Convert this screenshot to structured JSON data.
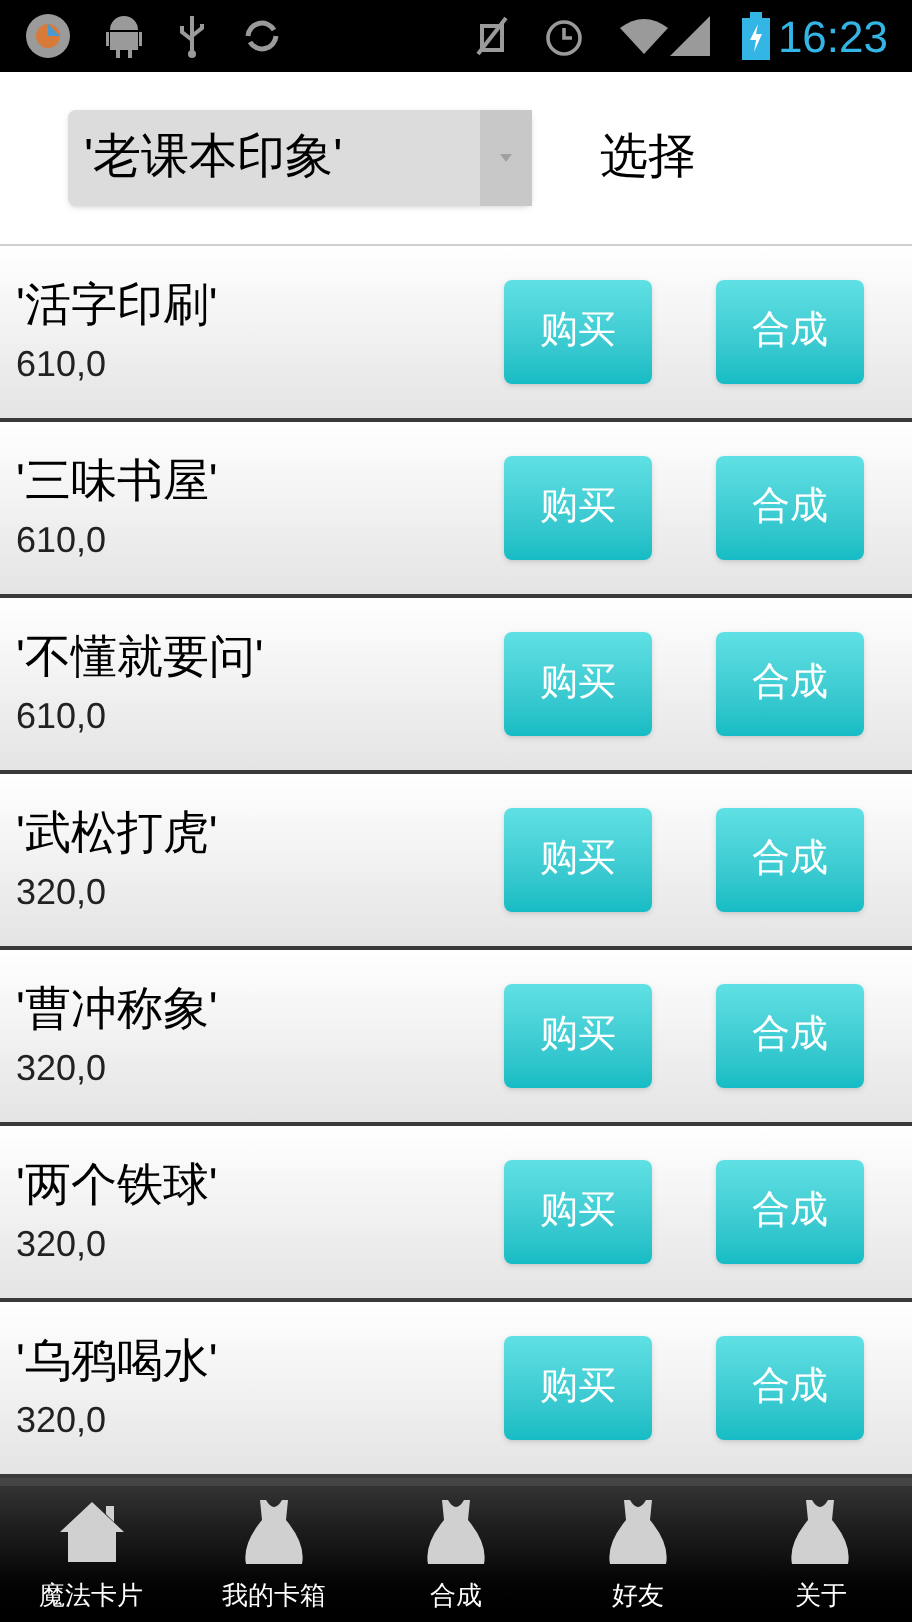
{
  "status_bar": {
    "time": "16:23"
  },
  "header": {
    "dropdown_value": "'老课本印象'",
    "select_button": "选择"
  },
  "cards": [
    {
      "name": "'活字印刷'",
      "price": "610,0",
      "buy": "购买",
      "combine": "合成"
    },
    {
      "name": "'三味书屋'",
      "price": "610,0",
      "buy": "购买",
      "combine": "合成"
    },
    {
      "name": "'不懂就要问'",
      "price": "610,0",
      "buy": "购买",
      "combine": "合成"
    },
    {
      "name": "'武松打虎'",
      "price": "320,0",
      "buy": "购买",
      "combine": "合成"
    },
    {
      "name": "'曹冲称象'",
      "price": "320,0",
      "buy": "购买",
      "combine": "合成"
    },
    {
      "name": "'两个铁球'",
      "price": "320,0",
      "buy": "购买",
      "combine": "合成"
    },
    {
      "name": "'乌鸦喝水'",
      "price": "320,0",
      "buy": "购买",
      "combine": "合成"
    }
  ],
  "bottom_nav": [
    {
      "label": "魔法卡片",
      "kind": "house"
    },
    {
      "label": "我的卡箱",
      "kind": "dress"
    },
    {
      "label": "合成",
      "kind": "dress"
    },
    {
      "label": "好友",
      "kind": "dress"
    },
    {
      "label": "关于",
      "kind": "dress"
    }
  ]
}
